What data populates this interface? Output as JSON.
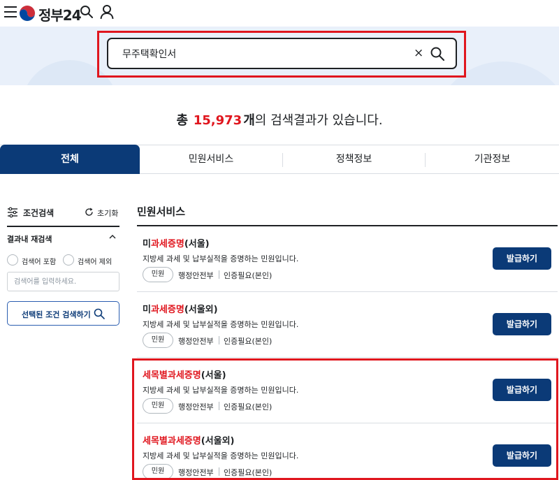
{
  "header": {
    "logo_text": "정부24",
    "icons": [
      "menu-icon",
      "emblem-icon",
      "search-icon",
      "user-icon"
    ]
  },
  "search": {
    "query": "무주택확인서",
    "clear_symbol": "×"
  },
  "result_summary": {
    "prefix": "총",
    "count": "15,973",
    "unit": "개",
    "suffix": "의 검색결과가 있습니다."
  },
  "tabs": [
    {
      "label": "전체",
      "active": true
    },
    {
      "label": "민원서비스",
      "active": false
    },
    {
      "label": "정책정보",
      "active": false
    },
    {
      "label": "기관정보",
      "active": false
    }
  ],
  "sidebar": {
    "title": "조건검색",
    "reset_label": "초기화",
    "section_title": "결과내 재검색",
    "radio_include": "검색어 포함",
    "radio_exclude": "검색어 제외",
    "input_placeholder": "검색어를 입력하세요.",
    "search_button": "선택된 조건 검색하기"
  },
  "main": {
    "section_title": "민원서비스",
    "items": [
      {
        "title_prefix": "미",
        "title_keyword": "과세증명",
        "title_suffix": "(서울)",
        "desc": "지방세 과세 및 납부실적을 증명하는 민원입니다.",
        "badge": "민원",
        "agency": "행정안전부",
        "auth": "인증필요(본인)",
        "button": "발급하기"
      },
      {
        "title_prefix": "미",
        "title_keyword": "과세증명",
        "title_suffix": "(서울외)",
        "desc": "지방세 과세 및 납부실적을 증명하는 민원입니다.",
        "badge": "민원",
        "agency": "행정안전부",
        "auth": "인증필요(본인)",
        "button": "발급하기"
      },
      {
        "title_prefix": "",
        "title_keyword": "세목별과세증명",
        "title_suffix": "(서울)",
        "desc": "지방세 과세 및 납부실적을 증명하는 민원입니다.",
        "badge": "민원",
        "agency": "행정안전부",
        "auth": "인증필요(본인)",
        "button": "발급하기"
      },
      {
        "title_prefix": "",
        "title_keyword": "세목별과세증명",
        "title_suffix": "(서울외)",
        "desc": "지방세 과세 및 납부실적을 증명하는 민원입니다.",
        "badge": "민원",
        "agency": "행정안전부",
        "auth": "인증필요(본인)",
        "button": "발급하기"
      }
    ]
  },
  "colors": {
    "primary": "#0b3a77",
    "highlight": "#e0161e",
    "search_band": "#e9f0fa"
  }
}
